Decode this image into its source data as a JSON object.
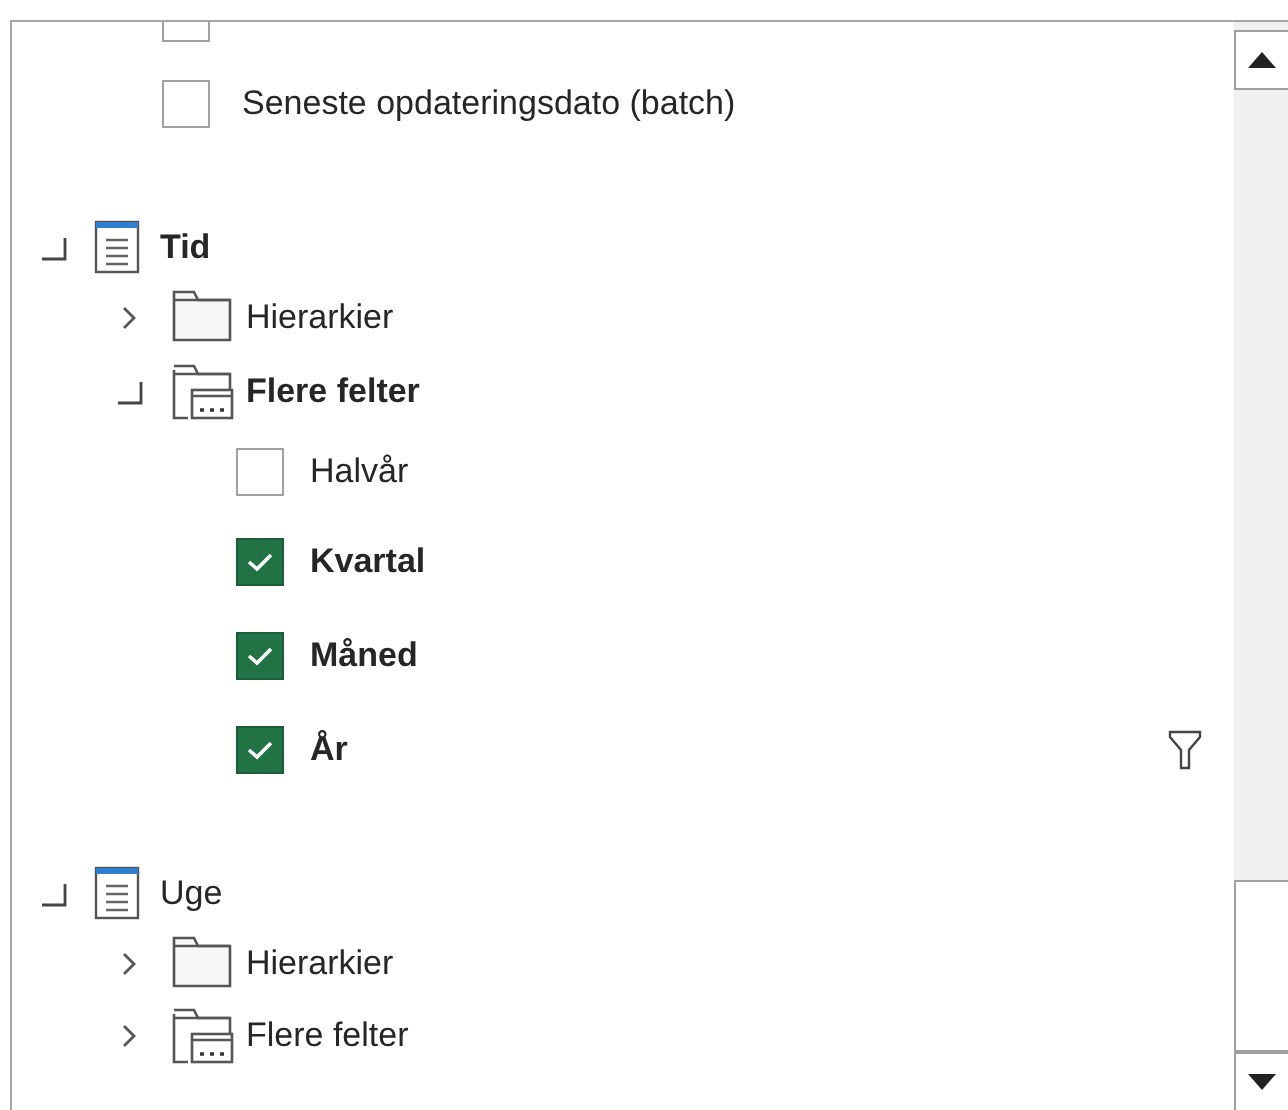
{
  "cut_field": {
    "checked": false
  },
  "fields": [
    {
      "label": "Seneste opdateringsdato (batch)",
      "checked": false
    }
  ],
  "tables": [
    {
      "name": "Tid",
      "expanded": true,
      "active": true,
      "folders": [
        {
          "name": "Hierarkier",
          "kind": "hierarchy",
          "expanded": false,
          "active": false
        },
        {
          "name": "Flere felter",
          "kind": "more_fields",
          "expanded": true,
          "active": true,
          "fields": [
            {
              "label": "Halvår",
              "checked": false,
              "filtered": false
            },
            {
              "label": "Kvartal",
              "checked": true,
              "filtered": false
            },
            {
              "label": "Måned",
              "checked": true,
              "filtered": false
            },
            {
              "label": "År",
              "checked": true,
              "filtered": true
            }
          ]
        }
      ]
    },
    {
      "name": "Uge",
      "expanded": true,
      "active": false,
      "folders": [
        {
          "name": "Hierarkier",
          "kind": "hierarchy",
          "expanded": false,
          "active": false
        },
        {
          "name": "Flere felter",
          "kind": "more_fields",
          "expanded": false,
          "active": false
        }
      ]
    }
  ]
}
